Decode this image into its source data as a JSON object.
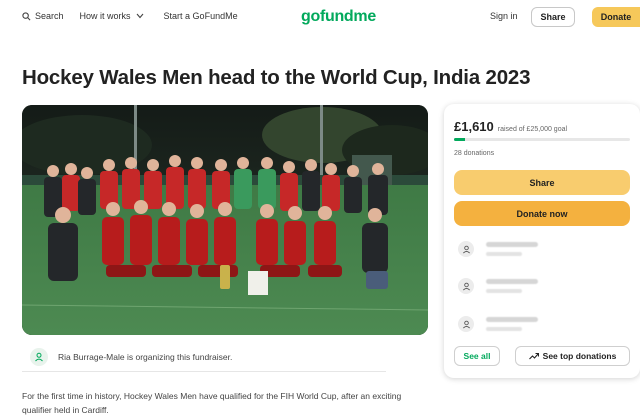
{
  "header": {
    "search_label": "Search",
    "how_it_works_label": "How it works",
    "start_label": "Start a GoFundMe",
    "logo_text": "gofundme",
    "signin_label": "Sign in",
    "share_label": "Share",
    "donate_label": "Donate"
  },
  "campaign": {
    "title": "Hockey Wales Men head to the World Cup, India 2023",
    "organizer_text": "Ria Burrage-Male is organizing this fundraiser.",
    "description": "For the first time in history, Hockey Wales Men have qualified for the FIH World Cup, after an exciting qualifier held in Cardiff."
  },
  "sidebar": {
    "raised_amount": "£1,610",
    "raised_goal": "raised of £25,000 goal",
    "progress_fraction": 0.0644,
    "donations_count": "28 donations",
    "share_button": "Share",
    "donate_button": "Donate now",
    "see_all_button": "See all",
    "see_top_button": "See top donations"
  },
  "colors": {
    "brand_green": "#02a95c",
    "share_yellow": "#f8cc6e",
    "donate_orange": "#f4b13f"
  },
  "icons": {
    "search": "search-icon",
    "chevron": "chevron-down-icon",
    "organizer": "person-icon",
    "donor": "person-icon",
    "trend": "trending-up-icon"
  }
}
